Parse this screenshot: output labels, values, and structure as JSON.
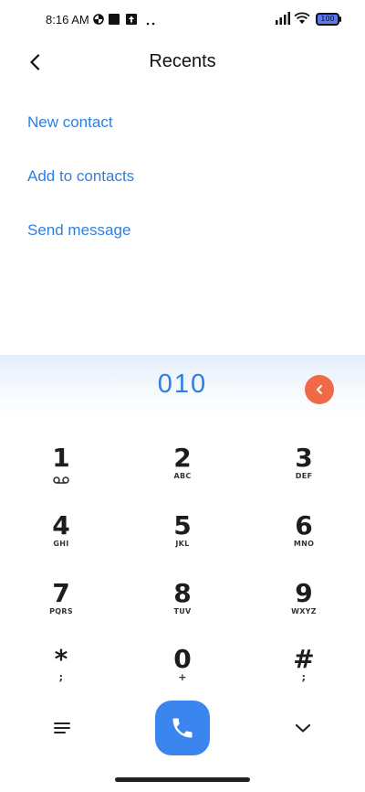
{
  "status_bar": {
    "time": "8:16 AM",
    "battery": "100",
    "icons": [
      "pie-chart-icon",
      "square-icon",
      "upload-box-icon",
      "more-dots-icon",
      "signal-icon",
      "wifi-icon",
      "battery-icon"
    ]
  },
  "header": {
    "title": "Recents",
    "back_icon": "chevron-left-icon"
  },
  "actions": {
    "new_contact": "New contact",
    "add_to_contacts": "Add to contacts",
    "send_message": "Send message"
  },
  "dialer": {
    "number": "010",
    "keys": [
      {
        "digit": "1",
        "letters": ""
      },
      {
        "digit": "2",
        "letters": "ABC"
      },
      {
        "digit": "3",
        "letters": "DEF"
      },
      {
        "digit": "4",
        "letters": "GHI"
      },
      {
        "digit": "5",
        "letters": "JKL"
      },
      {
        "digit": "6",
        "letters": "MNO"
      },
      {
        "digit": "7",
        "letters": "PQRS"
      },
      {
        "digit": "8",
        "letters": "TUV"
      },
      {
        "digit": "9",
        "letters": "WXYZ"
      },
      {
        "digit": "*",
        "letters": ";"
      },
      {
        "digit": "0",
        "letters": "+"
      },
      {
        "digit": "#",
        "letters": ";"
      }
    ]
  },
  "colors": {
    "accent": "#2f80e0",
    "call_button": "#3a86ee",
    "backspace": "#f06a48"
  }
}
